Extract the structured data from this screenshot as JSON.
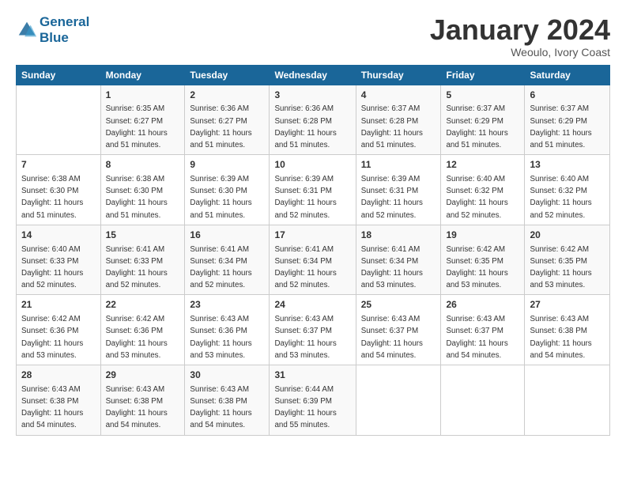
{
  "header": {
    "logo_line1": "General",
    "logo_line2": "Blue",
    "month": "January 2024",
    "location": "Weoulo, Ivory Coast"
  },
  "days_of_week": [
    "Sunday",
    "Monday",
    "Tuesday",
    "Wednesday",
    "Thursday",
    "Friday",
    "Saturday"
  ],
  "weeks": [
    [
      {
        "day": "",
        "sunrise": "",
        "sunset": "",
        "daylight": ""
      },
      {
        "day": "1",
        "sunrise": "Sunrise: 6:35 AM",
        "sunset": "Sunset: 6:27 PM",
        "daylight": "Daylight: 11 hours and 51 minutes."
      },
      {
        "day": "2",
        "sunrise": "Sunrise: 6:36 AM",
        "sunset": "Sunset: 6:27 PM",
        "daylight": "Daylight: 11 hours and 51 minutes."
      },
      {
        "day": "3",
        "sunrise": "Sunrise: 6:36 AM",
        "sunset": "Sunset: 6:28 PM",
        "daylight": "Daylight: 11 hours and 51 minutes."
      },
      {
        "day": "4",
        "sunrise": "Sunrise: 6:37 AM",
        "sunset": "Sunset: 6:28 PM",
        "daylight": "Daylight: 11 hours and 51 minutes."
      },
      {
        "day": "5",
        "sunrise": "Sunrise: 6:37 AM",
        "sunset": "Sunset: 6:29 PM",
        "daylight": "Daylight: 11 hours and 51 minutes."
      },
      {
        "day": "6",
        "sunrise": "Sunrise: 6:37 AM",
        "sunset": "Sunset: 6:29 PM",
        "daylight": "Daylight: 11 hours and 51 minutes."
      }
    ],
    [
      {
        "day": "7",
        "sunrise": "Sunrise: 6:38 AM",
        "sunset": "Sunset: 6:30 PM",
        "daylight": "Daylight: 11 hours and 51 minutes."
      },
      {
        "day": "8",
        "sunrise": "Sunrise: 6:38 AM",
        "sunset": "Sunset: 6:30 PM",
        "daylight": "Daylight: 11 hours and 51 minutes."
      },
      {
        "day": "9",
        "sunrise": "Sunrise: 6:39 AM",
        "sunset": "Sunset: 6:30 PM",
        "daylight": "Daylight: 11 hours and 51 minutes."
      },
      {
        "day": "10",
        "sunrise": "Sunrise: 6:39 AM",
        "sunset": "Sunset: 6:31 PM",
        "daylight": "Daylight: 11 hours and 52 minutes."
      },
      {
        "day": "11",
        "sunrise": "Sunrise: 6:39 AM",
        "sunset": "Sunset: 6:31 PM",
        "daylight": "Daylight: 11 hours and 52 minutes."
      },
      {
        "day": "12",
        "sunrise": "Sunrise: 6:40 AM",
        "sunset": "Sunset: 6:32 PM",
        "daylight": "Daylight: 11 hours and 52 minutes."
      },
      {
        "day": "13",
        "sunrise": "Sunrise: 6:40 AM",
        "sunset": "Sunset: 6:32 PM",
        "daylight": "Daylight: 11 hours and 52 minutes."
      }
    ],
    [
      {
        "day": "14",
        "sunrise": "Sunrise: 6:40 AM",
        "sunset": "Sunset: 6:33 PM",
        "daylight": "Daylight: 11 hours and 52 minutes."
      },
      {
        "day": "15",
        "sunrise": "Sunrise: 6:41 AM",
        "sunset": "Sunset: 6:33 PM",
        "daylight": "Daylight: 11 hours and 52 minutes."
      },
      {
        "day": "16",
        "sunrise": "Sunrise: 6:41 AM",
        "sunset": "Sunset: 6:34 PM",
        "daylight": "Daylight: 11 hours and 52 minutes."
      },
      {
        "day": "17",
        "sunrise": "Sunrise: 6:41 AM",
        "sunset": "Sunset: 6:34 PM",
        "daylight": "Daylight: 11 hours and 52 minutes."
      },
      {
        "day": "18",
        "sunrise": "Sunrise: 6:41 AM",
        "sunset": "Sunset: 6:34 PM",
        "daylight": "Daylight: 11 hours and 53 minutes."
      },
      {
        "day": "19",
        "sunrise": "Sunrise: 6:42 AM",
        "sunset": "Sunset: 6:35 PM",
        "daylight": "Daylight: 11 hours and 53 minutes."
      },
      {
        "day": "20",
        "sunrise": "Sunrise: 6:42 AM",
        "sunset": "Sunset: 6:35 PM",
        "daylight": "Daylight: 11 hours and 53 minutes."
      }
    ],
    [
      {
        "day": "21",
        "sunrise": "Sunrise: 6:42 AM",
        "sunset": "Sunset: 6:36 PM",
        "daylight": "Daylight: 11 hours and 53 minutes."
      },
      {
        "day": "22",
        "sunrise": "Sunrise: 6:42 AM",
        "sunset": "Sunset: 6:36 PM",
        "daylight": "Daylight: 11 hours and 53 minutes."
      },
      {
        "day": "23",
        "sunrise": "Sunrise: 6:43 AM",
        "sunset": "Sunset: 6:36 PM",
        "daylight": "Daylight: 11 hours and 53 minutes."
      },
      {
        "day": "24",
        "sunrise": "Sunrise: 6:43 AM",
        "sunset": "Sunset: 6:37 PM",
        "daylight": "Daylight: 11 hours and 53 minutes."
      },
      {
        "day": "25",
        "sunrise": "Sunrise: 6:43 AM",
        "sunset": "Sunset: 6:37 PM",
        "daylight": "Daylight: 11 hours and 54 minutes."
      },
      {
        "day": "26",
        "sunrise": "Sunrise: 6:43 AM",
        "sunset": "Sunset: 6:37 PM",
        "daylight": "Daylight: 11 hours and 54 minutes."
      },
      {
        "day": "27",
        "sunrise": "Sunrise: 6:43 AM",
        "sunset": "Sunset: 6:38 PM",
        "daylight": "Daylight: 11 hours and 54 minutes."
      }
    ],
    [
      {
        "day": "28",
        "sunrise": "Sunrise: 6:43 AM",
        "sunset": "Sunset: 6:38 PM",
        "daylight": "Daylight: 11 hours and 54 minutes."
      },
      {
        "day": "29",
        "sunrise": "Sunrise: 6:43 AM",
        "sunset": "Sunset: 6:38 PM",
        "daylight": "Daylight: 11 hours and 54 minutes."
      },
      {
        "day": "30",
        "sunrise": "Sunrise: 6:43 AM",
        "sunset": "Sunset: 6:38 PM",
        "daylight": "Daylight: 11 hours and 54 minutes."
      },
      {
        "day": "31",
        "sunrise": "Sunrise: 6:44 AM",
        "sunset": "Sunset: 6:39 PM",
        "daylight": "Daylight: 11 hours and 55 minutes."
      },
      {
        "day": "",
        "sunrise": "",
        "sunset": "",
        "daylight": ""
      },
      {
        "day": "",
        "sunrise": "",
        "sunset": "",
        "daylight": ""
      },
      {
        "day": "",
        "sunrise": "",
        "sunset": "",
        "daylight": ""
      }
    ]
  ]
}
